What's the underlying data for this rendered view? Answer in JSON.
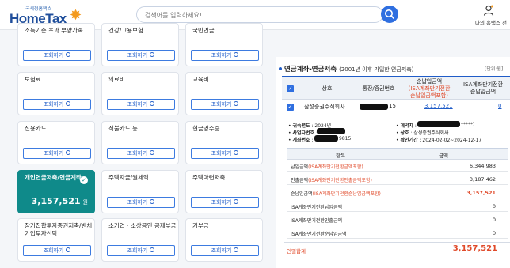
{
  "header": {
    "logo_sub": "국세청홈택스",
    "logo_main": "HomeTax",
    "search_placeholder": "검색어를 입력하세요!",
    "user_label": "나의 홈택스",
    "user_extra": "전"
  },
  "cards": {
    "btn_label": "조회하기",
    "items": [
      {
        "title": "소득기준 초과 부양가족"
      },
      {
        "title": "건강/고용보험"
      },
      {
        "title": "국민연금"
      },
      {
        "title": "보험료"
      },
      {
        "title": "의료비"
      },
      {
        "title": "교육비"
      },
      {
        "title": "신용카드"
      },
      {
        "title": "직불카드 등"
      },
      {
        "title": "현금영수증"
      },
      {
        "title": "개인연금저축/연금계좌",
        "amount": "3,157,521",
        "unit": "원"
      },
      {
        "title": "주택자금/월세액"
      },
      {
        "title": "주택마련저축"
      },
      {
        "title": "장기집합투자증권저축/벤처기업투자신탁"
      },
      {
        "title": "소기업 · 소상공인 공제부금"
      },
      {
        "title": "기부금"
      }
    ]
  },
  "panel": {
    "title": "연금계좌-연금저축",
    "subtitle": "(2001년 이후 가입한 연금저축)",
    "unit": "[단위:원]",
    "columns": {
      "select": "",
      "company": "상호",
      "account": "통장/증권번호",
      "net_payment_1": "순납입금액",
      "net_payment_2": "(ISA계좌만기전환",
      "net_payment_3": "순납입금액포함)",
      "isa_1": "ISA계좌만기전환",
      "isa_2": "순납입금액"
    },
    "row": {
      "company": "삼성증권주식회사",
      "account_suffix": "15",
      "net_amount": "3,157,521",
      "isa_amount": "0"
    },
    "detail": {
      "deduction_year_label": "귀속년도",
      "deduction_year": "2024년",
      "contractor_label": "계약자",
      "contractor_suffix": "*****)",
      "bizno_label": "사업자번호",
      "company_label": "상호",
      "company": "삼성증권주식회사",
      "account_label": "계좌번호",
      "account_suffix": "9815",
      "period_label": "확인기간",
      "period": "2024-02-02~2024-12-17"
    },
    "inner_columns": {
      "item": "항목",
      "amount": "금액"
    },
    "inner_rows": [
      {
        "label": "납입금액",
        "note": "(ISA계좌만기전환금액포함)",
        "value": "6,344,983",
        "red": false
      },
      {
        "label": "인출금액",
        "note": "(ISA계좌만기전환인출금액포함)",
        "value": "3,187,462",
        "red": false
      },
      {
        "label": "순납입금액",
        "note": "(ISA계좌만기전환순납입금액포함)",
        "value": "3,157,521",
        "red": true
      },
      {
        "label": "ISA계좌만기전환납입금액",
        "note": "",
        "value": "0",
        "red": false
      },
      {
        "label": "ISA계좌만기전환인출금액",
        "note": "",
        "value": "0",
        "red": false
      },
      {
        "label": "ISA계좌만기전환순납입금액",
        "note": "",
        "value": "0",
        "red": false
      }
    ],
    "total_label": "인별합계",
    "total_value": "3,157,521"
  },
  "colors": {
    "accent": "#2f6fe0",
    "active_card": "#0f8a8a",
    "highlight_red": "#e04a2a"
  }
}
